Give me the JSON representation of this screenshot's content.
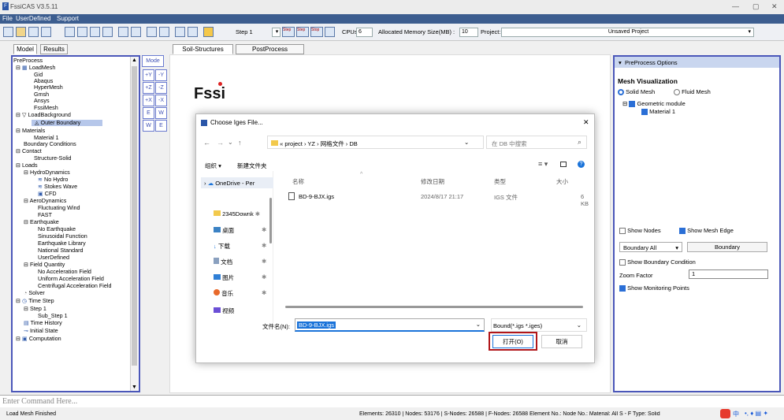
{
  "window": {
    "title": "FssiCAS V3.5.11",
    "min": "—",
    "max": "▢",
    "close": "✕"
  },
  "menu": [
    "File",
    "UserDefined",
    "Support"
  ],
  "toolbar": {
    "step": "Step 1",
    "step_btns": [
      "Step",
      "Step",
      "Stop"
    ],
    "cpus_label": "CPUs",
    "cpus_value": "6",
    "mem_label": "Allocated Memory Size(MB) :",
    "mem_value": "10",
    "project_label": "Project:",
    "project_value": "Unsaved Project"
  },
  "left_tabs": [
    "Model",
    "Results"
  ],
  "view_tabs": [
    "Soil-Structures",
    "PostProcess"
  ],
  "tree": [
    "PreProcess",
    "LoadMesh",
    "Gid",
    "Abaqus",
    "HyperMesh",
    "Gmsh",
    "Ansys",
    "FssiMesh",
    "LoadBackground",
    "Outer Boundary",
    "Materials",
    "Material 1",
    "Boundary Conditions",
    "Contact",
    "Structure-Solid",
    "Loads",
    "HydroDynamics",
    "No Hydro",
    "Stokes Wave",
    "CFD",
    "AeroDynamics",
    "Fluctuating Wind",
    "FAST",
    "Earthquake",
    "No Earthquake",
    "Sinusoidal Function",
    "Earthquake Library",
    "National Standard",
    "UserDefined",
    "Field Quantity",
    "No Acceleration Field",
    "Uniform Acceleration Field",
    "Centrifugal Acceleration Field",
    "Solver",
    "Time Step",
    "Step 1",
    "Sub_Step 1",
    "Time History",
    "Initial State",
    "Computation"
  ],
  "mini_tools": [
    "Mode",
    "+Y",
    "-Y",
    "+Z",
    "-Z",
    "+X",
    "-X",
    "E",
    "W",
    "W",
    "E"
  ],
  "logo": "Fssi",
  "dialog": {
    "title": "Choose Iges File...",
    "close": "✕",
    "path": [
      "«",
      "project",
      "›",
      "YZ",
      "›",
      "网格文件",
      "›",
      "DB"
    ],
    "search_placeholder": "在 DB 中搜索",
    "organize": "组织 ▾",
    "new_folder": "新建文件夹",
    "sidebar": [
      "OneDrive - Per",
      "2345Downk",
      "桌面",
      "下载",
      "文档",
      "图片",
      "音乐",
      "视频"
    ],
    "headers": [
      "名称",
      "修改日期",
      "类型",
      "大小"
    ],
    "files": [
      {
        "name": "BD-9-BJX.igs",
        "date": "2024/8/17 21:17",
        "type": "IGS 文件",
        "size": "6 KB"
      }
    ],
    "filename_label": "文件名(N):",
    "filename_value": "BD-9-BJX.igs",
    "filter": "Bound(*.igs *.iges)",
    "open": "打开(O)",
    "cancel": "取消"
  },
  "right": {
    "header": "PreProcess Options",
    "mesh_vis": "Mesh Visualization",
    "solid": "Solid Mesh",
    "fluid": "Fluid Mesh",
    "geo": "Geometric module",
    "mat": "Material 1",
    "show_nodes": "Show Nodes",
    "show_edge": "Show Mesh Edge",
    "boundary_all": "Boundary All",
    "boundary": "Boundary",
    "show_bc": "Show Boundary Condition",
    "zoom_label": "Zoom Factor",
    "zoom_value": "1",
    "show_mon": "Show Monitoring Points"
  },
  "command": "Enter Command Here...",
  "status": {
    "left": "Load Mesh Finished",
    "right": "Elements: 26310 | Nodes: 53176 | S-Nodes: 26588 | F-Nodes: 26588 Element No.:   Node No.:   Material:  All   S - F Type:  Solid",
    "ime": "中"
  }
}
